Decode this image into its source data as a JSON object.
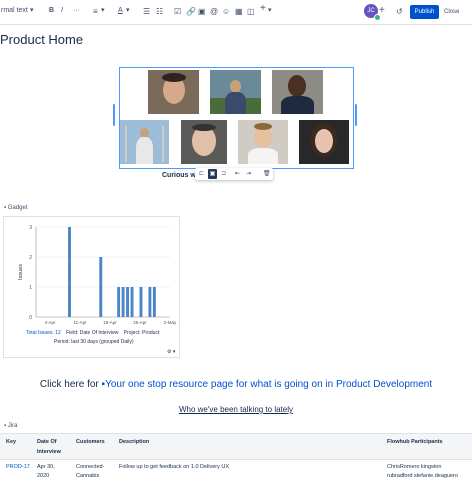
{
  "toolbar": {
    "text_style": "rmal text",
    "bold": "B",
    "italic": "I",
    "more_text": "···",
    "align": "≡",
    "text_color": "A",
    "bullets": "☰",
    "numbered": "☷",
    "action": "☑",
    "link": "🔗",
    "image": "▣",
    "mention": "@",
    "emoji": "☺",
    "table": "▦",
    "layout": "◫",
    "insert": "+",
    "avatar_initials": "JC",
    "add": "+",
    "undo": "↺",
    "publish_label": "Publish",
    "close_label": "Close"
  },
  "page": {
    "title": "Product Home",
    "caption": "Curious wh… …evelopment?"
  },
  "gadget": {
    "label": "Gadget",
    "y_axis_label": "Issues",
    "footer_total": "Total Issues: 12",
    "footer_field": "Field: Date Of Interview",
    "footer_project": "Project: Product",
    "footer_period": "Period: last 30 days (grouped Daily)",
    "settings": "⚙ ▾"
  },
  "chart_data": {
    "type": "bar",
    "x_tick_labels": [
      "4-Apr",
      "11-Apr",
      "18-Apr",
      "25-Apr",
      "2-May"
    ],
    "ylabel": "Issues",
    "ylim": [
      0,
      3
    ],
    "y_ticks": [
      0,
      1,
      2,
      3
    ],
    "bars": [
      {
        "day": 1,
        "value": 0
      },
      {
        "day": 2,
        "value": 0
      },
      {
        "day": 3,
        "value": 0
      },
      {
        "day": 4,
        "value": 0
      },
      {
        "day": 5,
        "value": 0
      },
      {
        "day": 6,
        "value": 0
      },
      {
        "day": 7,
        "value": 0
      },
      {
        "day": 8,
        "value": 3
      },
      {
        "day": 9,
        "value": 0
      },
      {
        "day": 10,
        "value": 0
      },
      {
        "day": 11,
        "value": 0
      },
      {
        "day": 12,
        "value": 0
      },
      {
        "day": 13,
        "value": 0
      },
      {
        "day": 14,
        "value": 0
      },
      {
        "day": 15,
        "value": 2
      },
      {
        "day": 16,
        "value": 0
      },
      {
        "day": 17,
        "value": 0
      },
      {
        "day": 18,
        "value": 0
      },
      {
        "day": 19,
        "value": 1
      },
      {
        "day": 20,
        "value": 1
      },
      {
        "day": 21,
        "value": 1
      },
      {
        "day": 22,
        "value": 1
      },
      {
        "day": 23,
        "value": 0
      },
      {
        "day": 24,
        "value": 1
      },
      {
        "day": 25,
        "value": 0
      },
      {
        "day": 26,
        "value": 1
      },
      {
        "day": 27,
        "value": 1
      },
      {
        "day": 28,
        "value": 0
      },
      {
        "day": 29,
        "value": 0
      },
      {
        "day": 30,
        "value": 0
      }
    ],
    "bar_color": "#4a86c5",
    "grid": true
  },
  "links": {
    "resource_prefix": "Click here for ",
    "resource_link": "Your one stop resource page for what is going on in Product Development",
    "talking_link": "Who we've been talking to lately"
  },
  "jira": {
    "label": "Jira",
    "headers": [
      "Key",
      "Date Of Interview",
      "Customers",
      "Description",
      "Flowhub Participants"
    ],
    "row": {
      "key": "PROD-17",
      "date_line1": "Apr 30,",
      "date_line2": "2020",
      "customer_line1": "Connected-",
      "customer_line2": "Cannabis",
      "description": "Follow up to get feedback on 1.0 Delivery UX",
      "participants_line1": "ChrisRomero kingston",
      "participants_line2": "rubradford stefanie.deaguero"
    }
  },
  "colors": {
    "brand": "#0052cc",
    "link": "#0052cc",
    "selection": "#4c9aff"
  }
}
